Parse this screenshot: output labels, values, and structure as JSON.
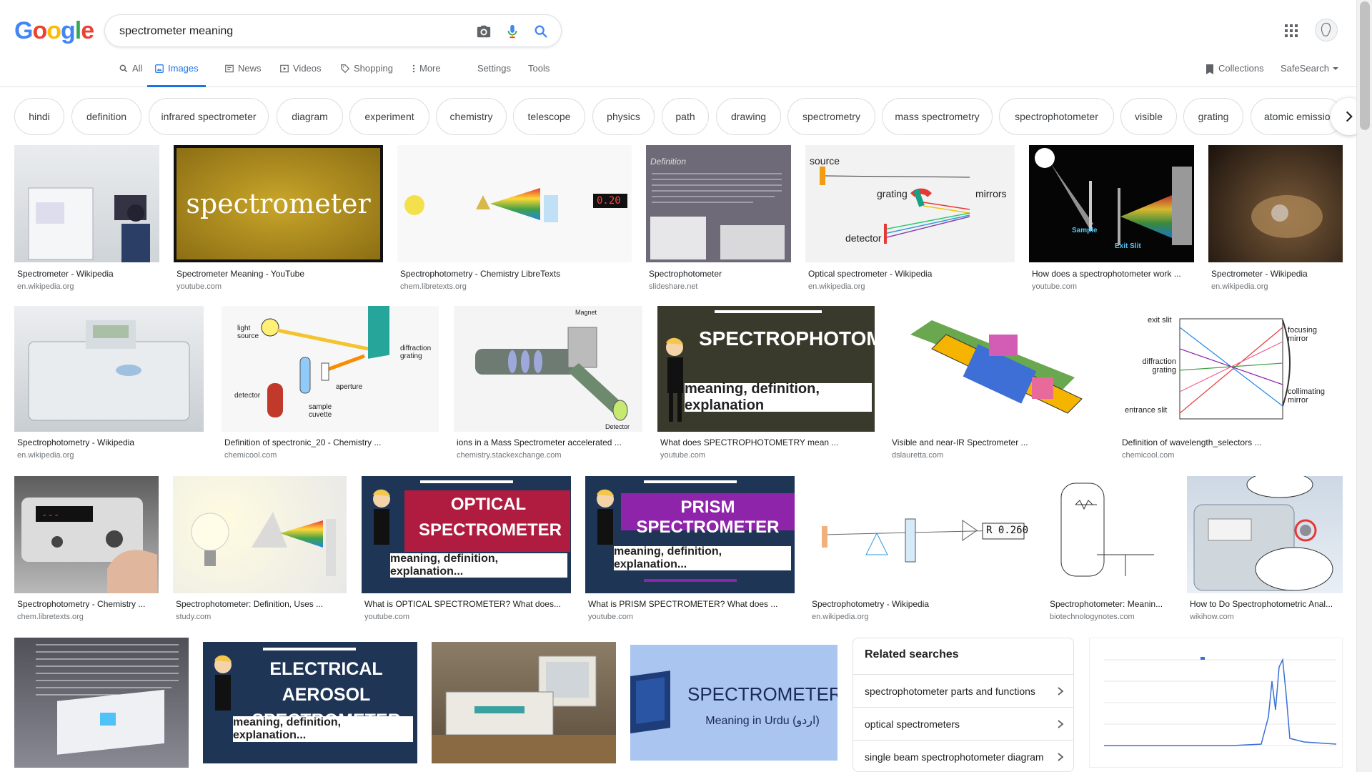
{
  "logo": {
    "text": "Google"
  },
  "search": {
    "query": "spectrometer meaning"
  },
  "tabs": [
    {
      "label": "All"
    },
    {
      "label": "Images"
    },
    {
      "label": "News"
    },
    {
      "label": "Videos"
    },
    {
      "label": "Shopping"
    },
    {
      "label": "More"
    },
    {
      "label": "Settings"
    },
    {
      "label": "Tools"
    }
  ],
  "header_right": {
    "collections": "Collections",
    "safesearch": "SafeSearch"
  },
  "chips": [
    "hindi",
    "definition",
    "infrared spectrometer",
    "diagram",
    "experiment",
    "chemistry",
    "telescope",
    "physics",
    "path",
    "drawing",
    "spectrometry",
    "mass spectrometry",
    "spectrophotometer",
    "visible",
    "grating",
    "atomic emissio"
  ],
  "results": [
    {
      "caption": "Spectrometer - Wikipedia",
      "domain": "en.wikipedia.org"
    },
    {
      "caption": "Spectrometer Meaning - YouTube",
      "domain": "youtube.com",
      "thumb_text": "spectrometer"
    },
    {
      "caption": "Spectrophotometry - Chemistry LibreTexts",
      "domain": "chem.libretexts.org",
      "thumb_text": "0.20"
    },
    {
      "caption": "Spectrophotometer",
      "domain": "slideshare.net",
      "thumb_text": "Definition"
    },
    {
      "caption": "Optical spectrometer - Wikipedia",
      "domain": "en.wikipedia.org",
      "labels": [
        "source",
        "grating",
        "mirrors",
        "detector"
      ]
    },
    {
      "caption": "How does a spectrophotometer work ...",
      "domain": "youtube.com",
      "labels": [
        "Sample",
        "Exit Slit"
      ]
    },
    {
      "caption": "Spectrometer - Wikipedia",
      "domain": "en.wikipedia.org"
    },
    {
      "caption": "Spectrophotometry - Wikipedia",
      "domain": "en.wikipedia.org"
    },
    {
      "caption": "Definition of spectronic_20 - Chemistry ...",
      "domain": "chemicool.com",
      "labels": [
        "light source",
        "diffraction grating",
        "aperture",
        "detector",
        "sample cuvette"
      ]
    },
    {
      "caption": "ions in a Mass Spectrometer accelerated ...",
      "domain": "chemistry.stackexchange.com",
      "labels": [
        "Magnet",
        "Detector"
      ]
    },
    {
      "caption": "What does SPECTROPHOTOMETRY mean ...",
      "domain": "youtube.com",
      "thumb_text": "SPECTROPHOTOMETRY",
      "thumb_sub": "meaning, definition, explanation"
    },
    {
      "caption": "Visible and near-IR Spectrometer ...",
      "domain": "dslauretta.com"
    },
    {
      "caption": "Definition of wavelength_selectors ...",
      "domain": "chemicool.com",
      "labels": [
        "exit slit",
        "focusing mirror",
        "diffraction grating",
        "collimating mirror",
        "entrance slit"
      ]
    },
    {
      "caption": "Spectrophotometry - Chemistry ...",
      "domain": "chem.libretexts.org"
    },
    {
      "caption": "Spectrophotometer: Definition, Uses ...",
      "domain": "study.com"
    },
    {
      "caption": "What is OPTICAL SPECTROMETER? What does...",
      "domain": "youtube.com",
      "thumb_text": "OPTICAL SPECTROMETER",
      "thumb_sub": "meaning, definition, explanation..."
    },
    {
      "caption": "What is PRISM SPECTROMETER? What does ...",
      "domain": "youtube.com",
      "thumb_text": "PRISM SPECTROMETER",
      "thumb_sub": "meaning, definition, explanation..."
    },
    {
      "caption": "Spectrophotometry - Wikipedia",
      "domain": "en.wikipedia.org",
      "thumb_text": "R 0.260"
    },
    {
      "caption": "Spectrophotometer: Meanin...",
      "domain": "biotechnologynotes.com"
    },
    {
      "caption": "How to Do Spectrophotometric Anal...",
      "domain": "wikihow.com"
    },
    {
      "caption": "",
      "domain": ""
    },
    {
      "caption": "",
      "domain": "",
      "thumb_text": "ELECTRICAL AEROSOL SPECTROMETER",
      "thumb_sub": "meaning, definition, explanation..."
    },
    {
      "caption": "",
      "domain": ""
    },
    {
      "caption": "",
      "domain": "",
      "thumb_text": "SPECTROMETER",
      "thumb_sub": "Meaning in Urdu (اردو)"
    },
    {
      "caption": "",
      "domain": ""
    }
  ],
  "related": {
    "title": "Related searches",
    "items": [
      "spectrophotometer parts and functions",
      "optical spectrometers",
      "single beam spectrophotometer diagram"
    ]
  },
  "colors": {
    "accent": "#1a73e8",
    "text": "#202124",
    "muted": "#70757a",
    "border": "#dadce0"
  }
}
